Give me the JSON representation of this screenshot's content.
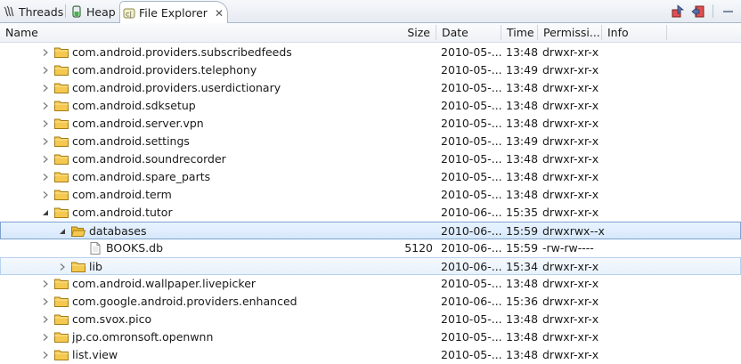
{
  "tabs": [
    {
      "label": "Threads",
      "icon": "threads-icon",
      "active": false
    },
    {
      "label": "Heap",
      "icon": "heap-icon",
      "active": false
    },
    {
      "label": "File Explorer",
      "icon": "file-explorer-icon",
      "active": true,
      "close": "✕"
    }
  ],
  "toolbar": {
    "pull_icon": "pull-file-icon",
    "push_icon": "push-file-icon",
    "view_menu_icon": "view-menu-icon"
  },
  "columns": {
    "name": "Name",
    "size": "Size",
    "date": "Date",
    "time": "Time",
    "permissions": "Permissi...",
    "info": "Info"
  },
  "colors": {
    "selection_border": "#7da2ce",
    "selection_fill": "#d7e8fb",
    "folder": "#f5c94f"
  },
  "rows": [
    {
      "name": "com.android.providers.subscribedfeeds",
      "size": "",
      "date": "2010-05-...",
      "time": "13:48",
      "perm": "drwxr-xr-x",
      "depth": 0,
      "type": "folder",
      "expander": "collapsed"
    },
    {
      "name": "com.android.providers.telephony",
      "size": "",
      "date": "2010-05-...",
      "time": "13:49",
      "perm": "drwxr-xr-x",
      "depth": 0,
      "type": "folder",
      "expander": "collapsed"
    },
    {
      "name": "com.android.providers.userdictionary",
      "size": "",
      "date": "2010-05-...",
      "time": "13:48",
      "perm": "drwxr-xr-x",
      "depth": 0,
      "type": "folder",
      "expander": "collapsed"
    },
    {
      "name": "com.android.sdksetup",
      "size": "",
      "date": "2010-05-...",
      "time": "13:48",
      "perm": "drwxr-xr-x",
      "depth": 0,
      "type": "folder",
      "expander": "collapsed"
    },
    {
      "name": "com.android.server.vpn",
      "size": "",
      "date": "2010-05-...",
      "time": "13:48",
      "perm": "drwxr-xr-x",
      "depth": 0,
      "type": "folder",
      "expander": "collapsed"
    },
    {
      "name": "com.android.settings",
      "size": "",
      "date": "2010-05-...",
      "time": "13:49",
      "perm": "drwxr-xr-x",
      "depth": 0,
      "type": "folder",
      "expander": "collapsed"
    },
    {
      "name": "com.android.soundrecorder",
      "size": "",
      "date": "2010-05-...",
      "time": "13:48",
      "perm": "drwxr-xr-x",
      "depth": 0,
      "type": "folder",
      "expander": "collapsed"
    },
    {
      "name": "com.android.spare_parts",
      "size": "",
      "date": "2010-05-...",
      "time": "13:48",
      "perm": "drwxr-xr-x",
      "depth": 0,
      "type": "folder",
      "expander": "collapsed"
    },
    {
      "name": "com.android.term",
      "size": "",
      "date": "2010-05-...",
      "time": "13:48",
      "perm": "drwxr-xr-x",
      "depth": 0,
      "type": "folder",
      "expander": "collapsed"
    },
    {
      "name": "com.android.tutor",
      "size": "",
      "date": "2010-06-...",
      "time": "15:35",
      "perm": "drwxr-xr-x",
      "depth": 0,
      "type": "folder",
      "expander": "expanded"
    },
    {
      "name": "databases",
      "size": "",
      "date": "2010-06-...",
      "time": "15:59",
      "perm": "drwxrwx--x",
      "depth": 1,
      "type": "folder-open",
      "expander": "expanded",
      "state": "selected"
    },
    {
      "name": "BOOKS.db",
      "size": "5120",
      "date": "2010-06-...",
      "time": "15:59",
      "perm": "-rw-rw----",
      "depth": 2,
      "type": "file",
      "expander": "none"
    },
    {
      "name": "lib",
      "size": "",
      "date": "2010-06-...",
      "time": "15:34",
      "perm": "drwxr-xr-x",
      "depth": 1,
      "type": "folder",
      "expander": "collapsed",
      "state": "hover"
    },
    {
      "name": "com.android.wallpaper.livepicker",
      "size": "",
      "date": "2010-05-...",
      "time": "13:48",
      "perm": "drwxr-xr-x",
      "depth": 0,
      "type": "folder",
      "expander": "collapsed"
    },
    {
      "name": "com.google.android.providers.enhanced",
      "size": "",
      "date": "2010-06-...",
      "time": "15:36",
      "perm": "drwxr-xr-x",
      "depth": 0,
      "type": "folder",
      "expander": "collapsed"
    },
    {
      "name": "com.svox.pico",
      "size": "",
      "date": "2010-05-...",
      "time": "13:48",
      "perm": "drwxr-xr-x",
      "depth": 0,
      "type": "folder",
      "expander": "collapsed"
    },
    {
      "name": "jp.co.omronsoft.openwnn",
      "size": "",
      "date": "2010-05-...",
      "time": "13:48",
      "perm": "drwxr-xr-x",
      "depth": 0,
      "type": "folder",
      "expander": "collapsed"
    },
    {
      "name": "list.view",
      "size": "",
      "date": "2010-05-...",
      "time": "13:48",
      "perm": "drwxr-xr-x",
      "depth": 0,
      "type": "folder",
      "expander": "collapsed"
    }
  ]
}
